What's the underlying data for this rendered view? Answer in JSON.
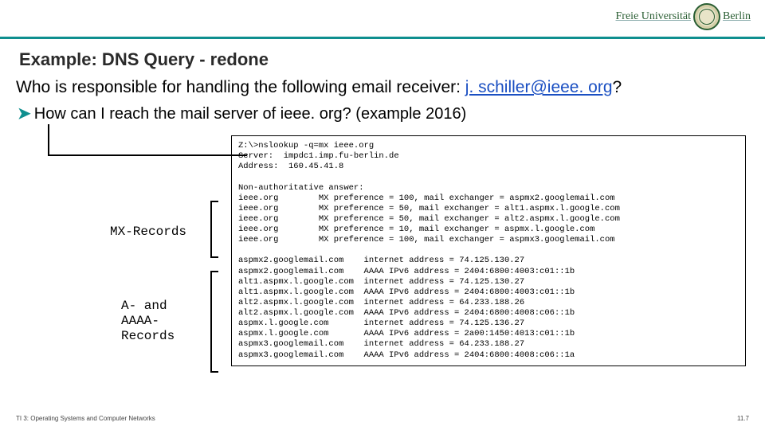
{
  "logo": {
    "part1": "Freie Universität",
    "part2": "Berlin"
  },
  "title": "Example: DNS Query - redone",
  "question": {
    "prefix": "Who is responsible for handling the following email receiver: ",
    "email": "j. schiller@ieee. org",
    "suffix": "?"
  },
  "bullet": "How can I reach the mail server of ieee. org? (example 2016)",
  "labels": {
    "mx": "MX-Records",
    "a_line1": "A- and",
    "a_line2": "AAAA-",
    "a_line3": "Records"
  },
  "terminal": {
    "header": "Z:\\>nslookup -q=mx ieee.org\nServer:  impdc1.imp.fu-berlin.de\nAddress:  160.45.41.8",
    "mx": "Non-authoritative answer:\nieee.org        MX preference = 100, mail exchanger = aspmx2.googlemail.com\nieee.org        MX preference = 50, mail exchanger = alt1.aspmx.l.google.com\nieee.org        MX preference = 50, mail exchanger = alt2.aspmx.l.google.com\nieee.org        MX preference = 10, mail exchanger = aspmx.l.google.com\nieee.org        MX preference = 100, mail exchanger = aspmx3.googlemail.com",
    "a": "aspmx2.googlemail.com    internet address = 74.125.130.27\naspmx2.googlemail.com    AAAA IPv6 address = 2404:6800:4003:c01::1b\nalt1.aspmx.l.google.com  internet address = 74.125.130.27\nalt1.aspmx.l.google.com  AAAA IPv6 address = 2404:6800:4003:c01::1b\nalt2.aspmx.l.google.com  internet address = 64.233.188.26\nalt2.aspmx.l.google.com  AAAA IPv6 address = 2404:6800:4008:c06::1b\naspmx.l.google.com       internet address = 74.125.136.27\naspmx.l.google.com       AAAA IPv6 address = 2a00:1450:4013:c01::1b\naspmx3.googlemail.com    internet address = 64.233.188.27\naspmx3.googlemail.com    AAAA IPv6 address = 2404:6800:4008:c06::1a"
  },
  "footer": {
    "left": "TI 3: Operating Systems and Computer Networks",
    "right": "11.7"
  }
}
